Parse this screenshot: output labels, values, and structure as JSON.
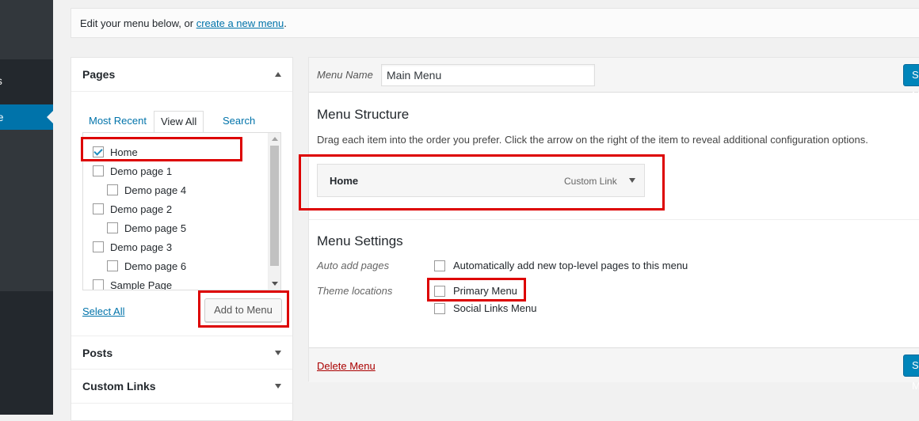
{
  "admin_menu": {
    "comments_fragment": "ts",
    "appearance_fragment": "nce"
  },
  "notice": {
    "text": "Edit your menu below, or ",
    "link": "create a new menu",
    "suffix": "."
  },
  "pages_box": {
    "title": "Pages",
    "tabs": [
      "Most Recent",
      "View All",
      "Search"
    ],
    "active_tab": "View All",
    "items": [
      {
        "label": "Home",
        "checked": true,
        "indent": 0
      },
      {
        "label": "Demo page 1",
        "checked": false,
        "indent": 0
      },
      {
        "label": "Demo page 4",
        "checked": false,
        "indent": 1
      },
      {
        "label": "Demo page 2",
        "checked": false,
        "indent": 0
      },
      {
        "label": "Demo page 5",
        "checked": false,
        "indent": 1
      },
      {
        "label": "Demo page 3",
        "checked": false,
        "indent": 0
      },
      {
        "label": "Demo page 6",
        "checked": false,
        "indent": 1
      },
      {
        "label": "Sample Page",
        "checked": false,
        "indent": 0
      }
    ],
    "select_all": "Select All",
    "add_button": "Add to Menu"
  },
  "other_boxes": [
    "Posts",
    "Custom Links"
  ],
  "menu_edit": {
    "name_label": "Menu Name",
    "name_value": "Main Menu",
    "save_label": "Save Menu",
    "structure_title": "Menu Structure",
    "structure_desc": "Drag each item into the order you prefer. Click the arrow on the right of the item to reveal additional configuration options.",
    "menu_items": [
      {
        "title": "Home",
        "type": "Custom Link"
      }
    ],
    "settings_title": "Menu Settings",
    "auto_add_label": "Auto add pages",
    "auto_add_option": "Automatically add new top-level pages to this menu",
    "theme_locations_label": "Theme locations",
    "locations": [
      {
        "label": "Primary Menu",
        "checked": false
      },
      {
        "label": "Social Links Menu",
        "checked": false
      }
    ],
    "delete_label": "Delete Menu"
  },
  "colors": {
    "highlight": "#dd0000",
    "primary_button": "#0085ba",
    "admin_bg": "#23282d",
    "active_menu": "#0073aa"
  }
}
